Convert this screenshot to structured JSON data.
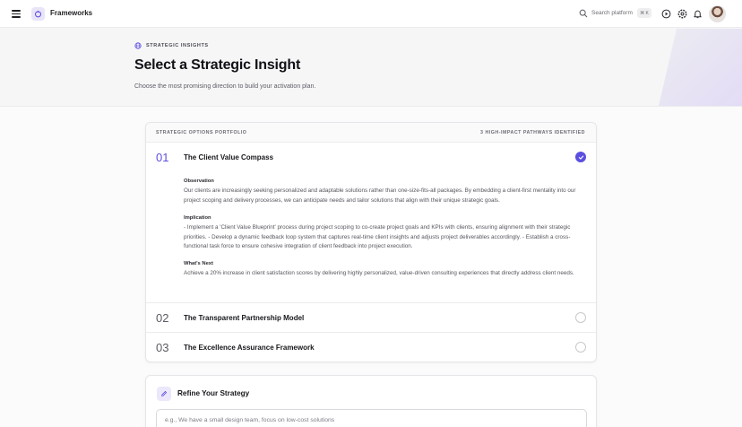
{
  "app": {
    "brand": "Frameworks"
  },
  "nav": {
    "search_label": "Search platform",
    "search_shortcut": "⌘ K",
    "icons": [
      "play-circle-icon",
      "settings-icon",
      "bell-icon"
    ]
  },
  "hero": {
    "eyebrow": "STRATEGIC INSIGHTS",
    "title": "Select a Strategic Insight",
    "subtitle": "Choose the most promising direction to build your activation plan."
  },
  "portfolio": {
    "header_left": "STRATEGIC OPTIONS PORTFOLIO",
    "header_right": "3 HIGH-IMPACT PATHWAYS IDENTIFIED",
    "options": [
      {
        "number": "01",
        "title": "The Client Value Compass",
        "selected": true,
        "sections": [
          {
            "label": "Observation",
            "text": "Our clients are increasingly seeking personalized and adaptable solutions rather than one-size-fits-all packages. By embedding a client-first mentality into our project scoping and delivery processes, we can anticipate needs and tailor solutions that align with their unique strategic goals."
          },
          {
            "label": "Implication",
            "text": "- Implement a 'Client Value Blueprint' process during project scoping to co-create project goals and KPIs with clients, ensuring alignment with their strategic priorities. - Develop a dynamic feedback loop system that captures real-time client insights and adjusts project deliverables accordingly. - Establish a cross-functional task force to ensure cohesive integration of client feedback into project execution."
          },
          {
            "label": "What's Next",
            "text": "Achieve a 20% increase in client satisfaction scores by delivering highly personalized, value-driven consulting experiences that directly address client needs."
          }
        ]
      },
      {
        "number": "02",
        "title": "The Transparent Partnership Model",
        "selected": false
      },
      {
        "number": "03",
        "title": "The Excellence Assurance Framework",
        "selected": false
      }
    ]
  },
  "refine": {
    "title": "Refine Your Strategy",
    "placeholder": "e.g., We have a small design team, focus on low-cost solutions"
  },
  "colors": {
    "accent": "#5b4fe0",
    "accent_soft": "#ece7fb"
  }
}
